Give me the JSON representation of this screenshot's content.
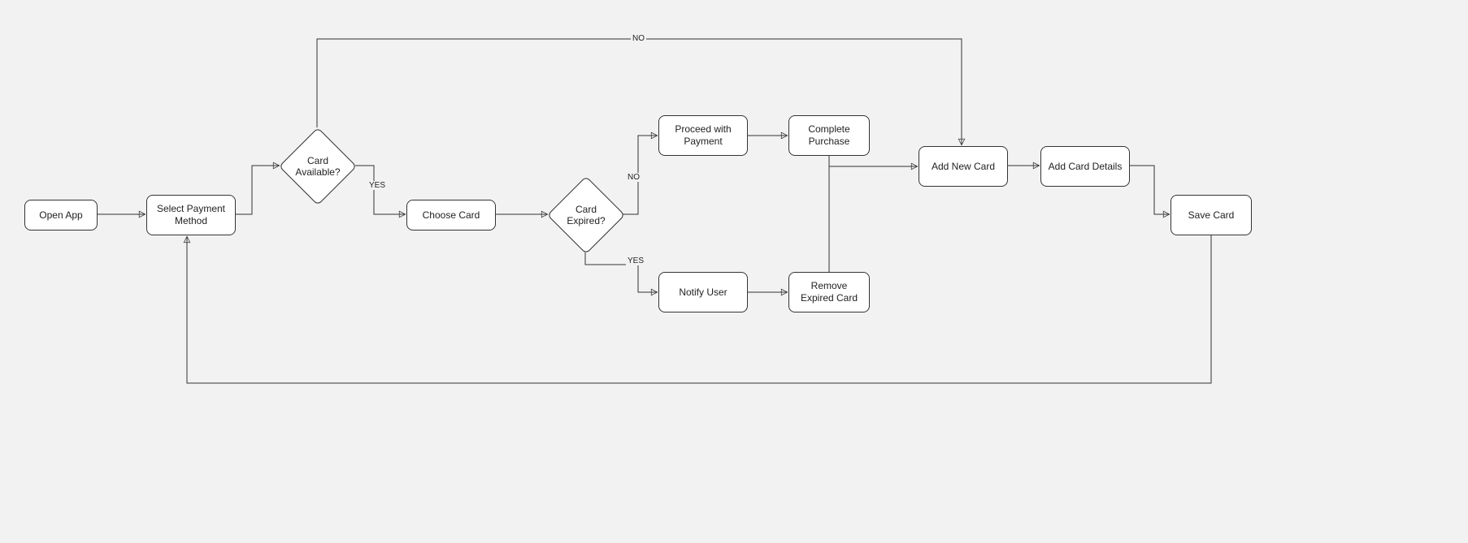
{
  "nodes": {
    "open_app": "Open  App",
    "select_payment": "Select Payment Method",
    "card_available": "Card Available?",
    "choose_card": "Choose Card",
    "card_expired": "Card Expired?",
    "proceed_payment": "Proceed with Payment",
    "complete_purchase": "Complete Purchase",
    "notify_user": "Notify User",
    "remove_expired": "Remove Expired Card",
    "add_new_card": "Add New Card",
    "add_card_details": "Add Card Details",
    "save_card": "Save Card"
  },
  "labels": {
    "yes1": "YES",
    "no1": "NO",
    "yes2": "YES",
    "no2": "NO"
  }
}
